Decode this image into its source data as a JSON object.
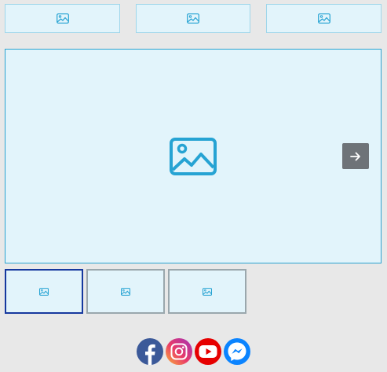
{
  "icons": {
    "image_placeholder": "image-icon",
    "next": "arrow-right-icon",
    "facebook": "facebook-icon",
    "instagram": "instagram-icon",
    "youtube": "youtube-icon",
    "messenger": "messenger-icon"
  },
  "colors": {
    "page_background": "#e8e8e8",
    "placeholder_fill": "#e2f4fb",
    "placeholder_icon": "#26a3d3",
    "active_thumb_border": "#16389e",
    "next_button": "#6e7378"
  },
  "gallery": {
    "thumbnails_count": 3,
    "active_thumbnail": 1
  }
}
